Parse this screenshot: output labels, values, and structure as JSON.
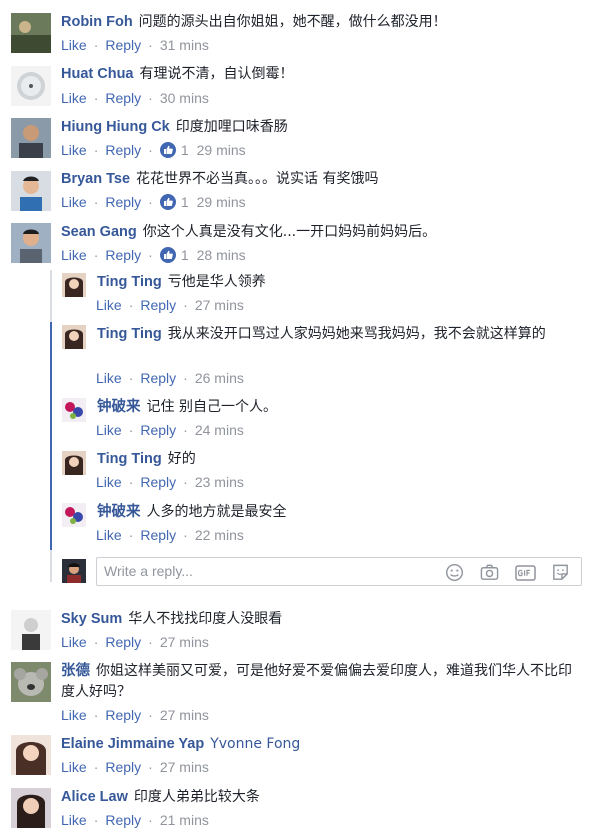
{
  "actions": {
    "like": "Like",
    "reply": "Reply",
    "dot": "·"
  },
  "comments": [
    {
      "name": "Robin Foh",
      "text": "问题的源头出自你姐姐，她不醒，做什么都没用！",
      "time": "31 mins"
    },
    {
      "name": "Huat Chua",
      "text": "有理说不清，自认倒霉！",
      "time": "30 mins"
    },
    {
      "name": "Hiung Hiung Ck",
      "text": "印度加哩口味香肠",
      "likes": "1",
      "time": "29 mins"
    },
    {
      "name": "Bryan Tse",
      "text": "花花世界不必当真。。。说实话 有奖饿吗",
      "likes": "1",
      "time": "29 mins"
    },
    {
      "name": "Sean Gang",
      "text": "你这个人真是没有文化...一开口妈妈前妈妈后。",
      "likes": "1",
      "time": "28 mins"
    }
  ],
  "replies": [
    {
      "name": "Ting Ting",
      "text": "亏他是华人领养",
      "time": "27 mins"
    },
    {
      "name": "Ting Ting",
      "text": "我从来没开口骂过人家妈妈她来骂我妈妈，我不会就这样算的",
      "time": "26 mins"
    },
    {
      "name": "钟破来",
      "text": "记住 别自己一个人。",
      "time": "24 mins"
    },
    {
      "name": "Ting Ting",
      "text": "好的",
      "time": "23 mins"
    },
    {
      "name": "钟破来",
      "text": "人多的地方就是最安全",
      "time": "22 mins"
    }
  ],
  "reply_box": {
    "placeholder": "Write a reply..."
  },
  "comments2": [
    {
      "name": "Sky Sum",
      "text": "华人不找找印度人没眼看",
      "time": "27 mins"
    },
    {
      "name": "张德",
      "text": "你姐这样美丽又可爱，可是他好爱不爱偏偏去爱印度人，难道我们华人不比印度人好吗？",
      "time": "27 mins"
    },
    {
      "name": "Elaine Jimmaine Yap",
      "tag": "Yvonne Fong",
      "time": "27 mins"
    },
    {
      "name": "Alice Law",
      "text": "印度人弟弟比较大条",
      "time": "21 mins"
    }
  ],
  "colors": {
    "link": "#365899",
    "action": "#4267b2",
    "meta": "#90949c",
    "thread": "#dadde1",
    "thread_active": "#4267b2"
  }
}
